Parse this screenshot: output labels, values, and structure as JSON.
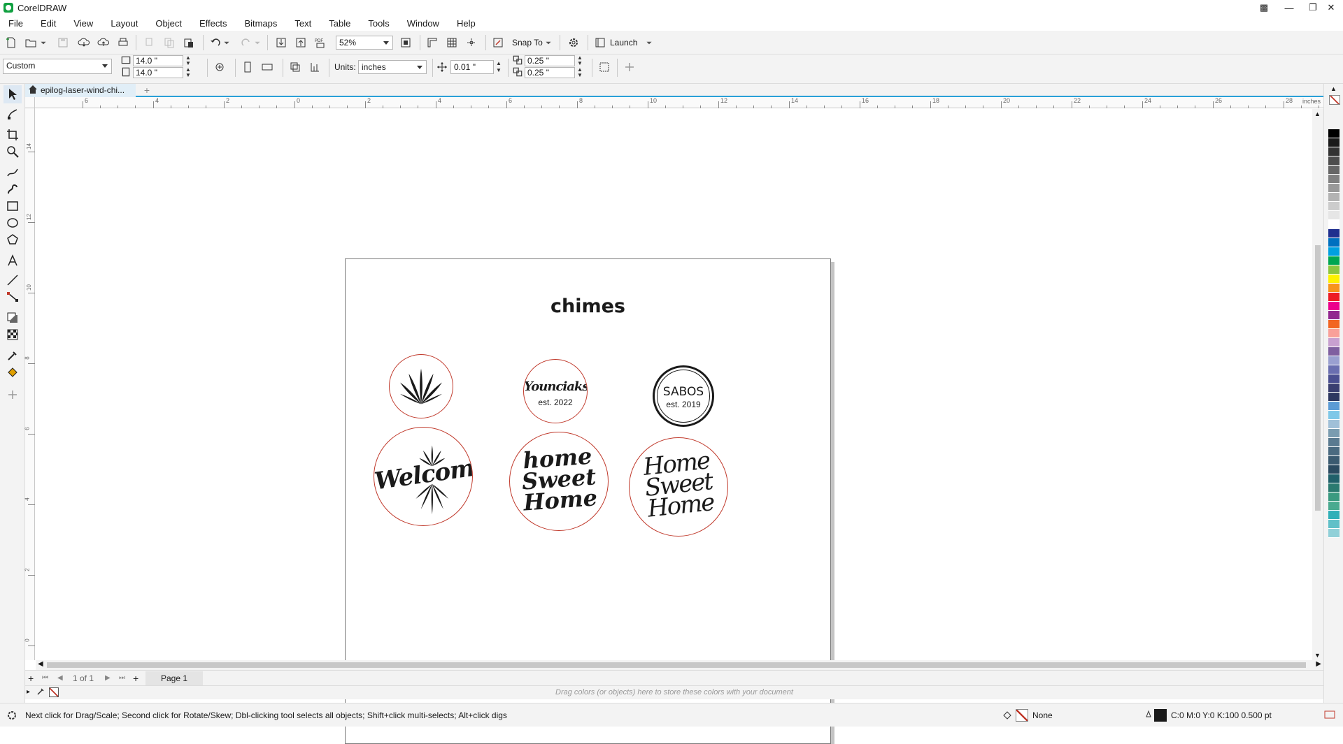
{
  "app": {
    "title": "CorelDRAW"
  },
  "menu": [
    "File",
    "Edit",
    "View",
    "Layout",
    "Object",
    "Effects",
    "Bitmaps",
    "Text",
    "Table",
    "Tools",
    "Window",
    "Help"
  ],
  "standard_toolbar": {
    "zoom_value": "52%",
    "snap_to_label": "Snap To",
    "launch_label": "Launch",
    "icons": [
      "new-document-icon",
      "open-icon",
      "save-icon",
      "import-cloud-icon",
      "export-cloud-icon",
      "print-icon",
      "cut-icon",
      "copy-icon",
      "paste-icon",
      "undo-icon",
      "redo-icon",
      "import-icon",
      "export-icon",
      "publish-pdf-icon",
      "full-screen-icon",
      "show-rulers-icon",
      "show-grid-icon",
      "show-guidelines-icon",
      "snap-icon",
      "options-gear-icon",
      "launch-icon"
    ]
  },
  "property_bar": {
    "page_preset": "Custom",
    "page_width": "14.0 \"",
    "page_height": "14.0 \"",
    "units_label": "Units:",
    "units_value": "inches",
    "nudge_value": "0.01 \"",
    "duplicate_x": "0.25 \"",
    "duplicate_y": "0.25 \""
  },
  "document_tab": {
    "label": "epilog-laser-wind-chi..."
  },
  "rulers": {
    "unit": "inches",
    "h_ticks": [
      "6",
      "4",
      "2",
      "0",
      "2",
      "4",
      "6",
      "8",
      "10",
      "12",
      "14",
      "16",
      "18",
      "20",
      "22",
      "24",
      "26",
      "28"
    ],
    "v_ticks": [
      "14",
      "12",
      "10",
      "8",
      "6",
      "4",
      "2",
      "0"
    ]
  },
  "page": {
    "title": "chimes",
    "chimes": [
      {
        "name": "chime-burst",
        "art": "burst"
      },
      {
        "name": "chime-younciaks",
        "line1": "Younciaks",
        "line2": "est. 2022"
      },
      {
        "name": "chime-sabos",
        "line1": "SABOS",
        "line2": "est. 2019"
      },
      {
        "name": "chime-welcome",
        "text": "Welcome"
      },
      {
        "name": "chime-home-sweet-home-bold",
        "line1": "home",
        "line2": "Sweet",
        "line3": "Home"
      },
      {
        "name": "chime-home-sweet-home-script",
        "line1": "Home",
        "line2": "Sweet",
        "line3": "Home"
      }
    ]
  },
  "page_navigator": {
    "counter": "1 of 1",
    "page_tab": "Page 1"
  },
  "document_palette": {
    "hint": "Drag colors (or objects) here to store these colors with your document"
  },
  "status": {
    "hint": "Next click for Drag/Scale; Second click for Rotate/Skew; Dbl-clicking tool selects all objects; Shift+click multi-selects; Alt+click digs",
    "fill_label": "None",
    "outline_label": "C:0 M:0 Y:0 K:100  0.500 pt"
  },
  "palette_colors": [
    "#000000",
    "#1a1a1a",
    "#333333",
    "#4d4d4d",
    "#666666",
    "#808080",
    "#999999",
    "#b3b3b3",
    "#cccccc",
    "#e6e6e6",
    "#ffffff",
    "#1f2f8f",
    "#0070c0",
    "#00a0e0",
    "#00a651",
    "#8dc63f",
    "#fff200",
    "#f7941d",
    "#ed1c24",
    "#ec008c",
    "#92278f",
    "#f26522",
    "#f9a099",
    "#c8a0d0",
    "#7f5fa0",
    "#9aa0d0",
    "#6a6fb0",
    "#4a4f90",
    "#3a3f70",
    "#2e3860",
    "#5b9bd5",
    "#7fc8e8",
    "#a0c0d8",
    "#7a9cb0",
    "#5a7a90",
    "#4a6a80",
    "#3a5a70",
    "#2a4a60",
    "#20606a",
    "#2a7a70",
    "#3a9a80",
    "#4aaa90",
    "#30b0b8",
    "#60c0c8",
    "#90d0d8"
  ]
}
